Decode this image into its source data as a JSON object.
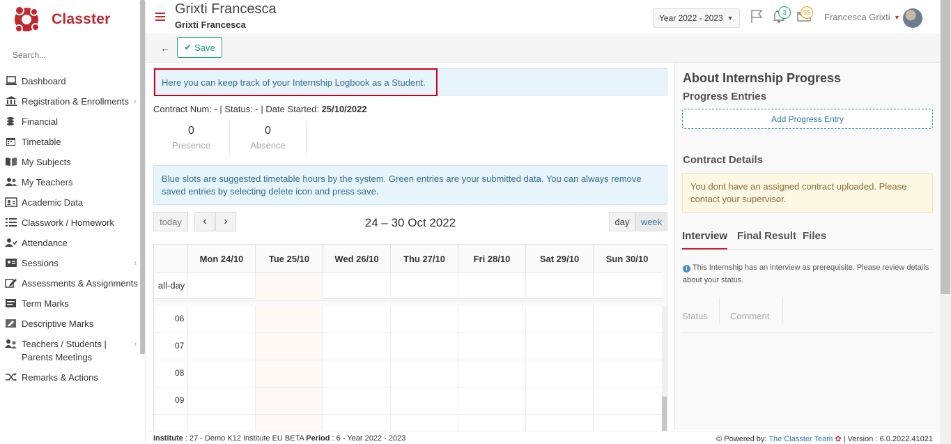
{
  "app": {
    "brand": "Classter",
    "accent": "#c1272d"
  },
  "sidebar": {
    "search_placeholder": "Search...",
    "items": [
      {
        "label": "Dashboard",
        "icon": "laptop-icon"
      },
      {
        "label": "Registration & Enrollments",
        "icon": "institution-icon"
      },
      {
        "label": "Financial",
        "icon": "coins-icon"
      },
      {
        "label": "Timetable",
        "icon": "calendar-icon"
      },
      {
        "label": "My Subjects",
        "icon": "book-icon"
      },
      {
        "label": "My Teachers",
        "icon": "users-icon"
      },
      {
        "label": "Academic Data",
        "icon": "id-card-icon"
      },
      {
        "label": "Classwork / Homework",
        "icon": "list-icon"
      },
      {
        "label": "Attendance",
        "icon": "user-check-icon"
      },
      {
        "label": "Sessions",
        "icon": "sessions-icon"
      },
      {
        "label": "Assessments & Assignments",
        "icon": "edit-icon"
      },
      {
        "label": "Term Marks",
        "icon": "term-marks-icon"
      },
      {
        "label": "Descriptive Marks",
        "icon": "descriptive-icon"
      },
      {
        "label": "Teachers / Students | Parents Meetings",
        "icon": "meeting-icon"
      },
      {
        "label": "Remarks & Actions",
        "icon": "shuffle-icon"
      }
    ]
  },
  "header": {
    "title": "Grixti Francesca",
    "subtitle": "Grixti Francesca",
    "year": "Year 2022 - 2023",
    "notifications_count": "3",
    "messages_count": "55",
    "user_name": "Francesca Grixti"
  },
  "toolbar": {
    "save_label": "Save"
  },
  "main": {
    "info_text": "Here you can keep track of your Internship Logbook as a Student.",
    "contract_line_prefix": "Contract Num: -   | Status: - | Date Started: ",
    "date_started": "25/10/2022",
    "stats": [
      {
        "value": "0",
        "label": "Presence"
      },
      {
        "value": "0",
        "label": "Absence"
      }
    ],
    "slots_note": "Blue slots are suggested timetable hours by the system. Green entries are your submitted data. You can always remove saved entries by selecting delete icon and press save.",
    "calendar": {
      "today_label": "today",
      "prev": "‹",
      "next": "›",
      "title": "24 – 30 Oct 2022",
      "day_label": "day",
      "week_label": "week",
      "days": [
        "Mon 24/10",
        "Tue 25/10",
        "Wed 26/10",
        "Thu 27/10",
        "Fri 28/10",
        "Sat 29/10",
        "Sun 30/10"
      ],
      "allday_label": "all-day",
      "hours": [
        "06",
        "07",
        "08",
        "09"
      ]
    }
  },
  "right": {
    "title": "About Internship Progress",
    "progress_heading": "Progress Entries",
    "add_entry_label": "Add Progress Entry",
    "contract_heading": "Contract Details",
    "contract_warning": "You dont have an assigned contract uploaded. Please contact your supervisor.",
    "tabs": [
      "Interview",
      "Final Result",
      "Files"
    ],
    "interview_note": "This Internship has an interview as prerequisite. Please review details about your status.",
    "table_cols": [
      "Status",
      "Comment"
    ]
  },
  "footer": {
    "institute_label": "Institute",
    "institute_value": " : 27 - Demo K12 Institute EU BETA ",
    "period_label": "Period",
    "period_value": " : 6 - Year 2022 - 2023",
    "powered_by": "Powered by: ",
    "team_link": "The Classter Team",
    "version": " | Version : 6.0.2022.41021"
  }
}
